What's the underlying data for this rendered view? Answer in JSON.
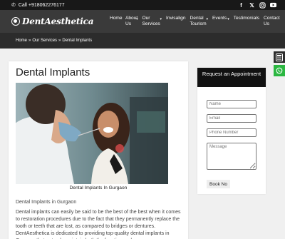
{
  "topbar": {
    "phone": "Call +918062276177",
    "social": [
      "facebook-icon",
      "x-icon",
      "instagram-icon",
      "youtube-icon"
    ]
  },
  "header": {
    "logo_text": "DentAesthetica",
    "nav": [
      {
        "label": "Home",
        "dropdown": false
      },
      {
        "label": "About Us",
        "dropdown": true
      },
      {
        "label": "Our Services",
        "dropdown": true
      },
      {
        "label": "Invisalign",
        "dropdown": false
      },
      {
        "label": "Dental Tourism",
        "dropdown": true
      },
      {
        "label": "Events",
        "dropdown": true
      },
      {
        "label": "Testimonials",
        "dropdown": false
      },
      {
        "label": "Contact Us",
        "dropdown": false
      }
    ]
  },
  "breadcrumb": {
    "items": [
      "Home",
      "Our Services",
      "Dental Implants"
    ],
    "separator": "»"
  },
  "main": {
    "title": "Dental Implants",
    "caption": "Dental Implants In Gurgaon",
    "subhead": "Dental Implants in Gurgaon",
    "paragraph": "Dental implants can easily be said to be the best of the best when it comes to restoration procedures due to the fact that they permanently replace the tooth or teeth that are lost, as compared to bridges or dentures. DentAesthetica is dedicated to providing top-quality dental implants in Gurgaon that not only maintain both the function and"
  },
  "form": {
    "title": "Request an Appointment",
    "name_placeholder": "Name",
    "email_placeholder": "Email",
    "phone_placeholder": "Phone Number",
    "message_placeholder": "Message",
    "submit_label": "Book No"
  },
  "colors": {
    "topbar": "#181818",
    "header": "#3a3a3a",
    "banner": "#2c2c2c",
    "whatsapp": "#2bb741"
  }
}
